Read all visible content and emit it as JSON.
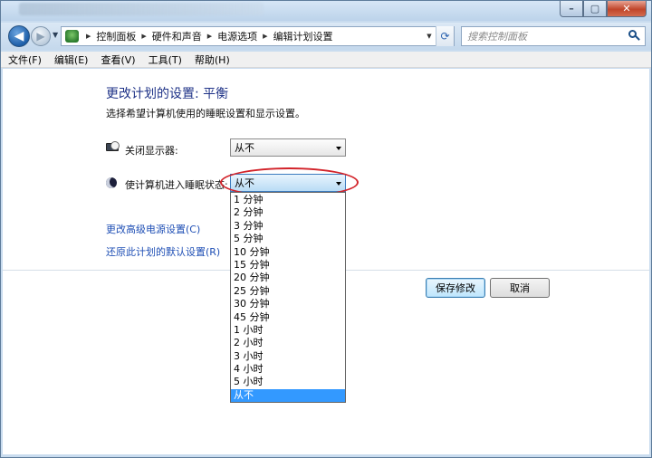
{
  "window": {
    "controls": {
      "minimize": "–",
      "maximize": "▢",
      "close": "✕"
    }
  },
  "nav": {
    "back_icon": "◀",
    "forward_icon": "▶",
    "history_icon": "▼",
    "breadcrumbs": [
      "控制面板",
      "硬件和声音",
      "电源选项",
      "编辑计划设置"
    ],
    "dropdown_icon": "▼",
    "refresh_icon": "⟳",
    "search_placeholder": "搜索控制面板"
  },
  "menu": {
    "items": [
      "文件(F)",
      "编辑(E)",
      "查看(V)",
      "工具(T)",
      "帮助(H)"
    ]
  },
  "page": {
    "title": "更改计划的设置: 平衡",
    "description": "选择希望计算机使用的睡眠设置和显示设置。",
    "display_off_label": "关闭显示器:",
    "display_off_value": "从不",
    "sleep_label": "使计算机进入睡眠状态:",
    "sleep_value": "从不",
    "advanced_link": "更改高级电源设置(C)",
    "restore_link": "还原此计划的默认设置(R)",
    "save_button": "保存修改",
    "cancel_button": "取消"
  },
  "dropdown": {
    "options": [
      "1 分钟",
      "2 分钟",
      "3 分钟",
      "5 分钟",
      "10 分钟",
      "15 分钟",
      "20 分钟",
      "25 分钟",
      "30 分钟",
      "45 分钟",
      "1 小时",
      "2 小时",
      "3 小时",
      "4 小时",
      "5 小时",
      "从不"
    ],
    "selected_index": 15
  },
  "colors": {
    "title": "#1e3287",
    "link": "#1f4fb5",
    "highlight": "#3399ff",
    "annotation": "#d2232a"
  }
}
